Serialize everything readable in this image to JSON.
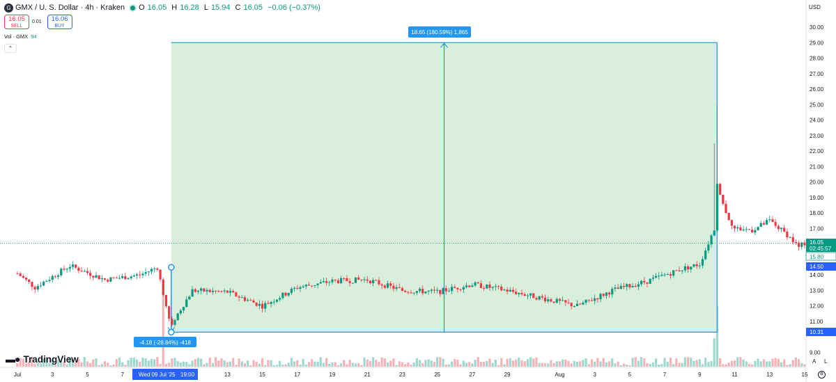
{
  "header": {
    "symbol_icon": "gmx-logo-icon",
    "title": "GMX / U. S. Dollar · 4h · Kraken",
    "open_label": "O",
    "open": "16.05",
    "high_label": "H",
    "high": "16.28",
    "low_label": "L",
    "low": "15.94",
    "close_label": "C",
    "close": "16.05",
    "change": "−0.06 (−0.37%)"
  },
  "trade": {
    "sell_price": "16.05",
    "sell_label": "SELL",
    "spread": "0.01",
    "buy_price": "16.06",
    "buy_label": "BUY"
  },
  "volume": {
    "label": "Vol · GMX",
    "value": "94"
  },
  "currency": "USD",
  "brand": "TradingView",
  "colors": {
    "up": "#089981",
    "down": "#f23645",
    "range_fill": "#d9eedb",
    "measure_blue": "#2962ff"
  },
  "measure": {
    "up_label": "18.65 (180.59%) 1,865",
    "down_label": "-4.18 (-28.84%) -418",
    "top_value": 29.0,
    "bottom_value": 10.31,
    "start_value": 14.5
  },
  "price_axis": {
    "ticks": [
      "30.00",
      "29.00",
      "28.00",
      "27.00",
      "26.00",
      "25.00",
      "24.00",
      "23.00",
      "22.00",
      "21.00",
      "20.00",
      "19.00",
      "18.00",
      "17.00",
      "14.00",
      "13.00",
      "12.00",
      "11.00",
      "9.00"
    ],
    "current_price": "16.05",
    "countdown": "02:45:57",
    "low_marker": "15.80",
    "start_marker": "14.50",
    "bottom_marker": "10.31"
  },
  "time_axis": {
    "labels": [
      "Jul",
      "3",
      "5",
      "7",
      "13",
      "15",
      "17",
      "19",
      "21",
      "23",
      "25",
      "27",
      "29",
      "Aug",
      "3",
      "5",
      "7",
      "9",
      "11",
      "13",
      "15"
    ],
    "crosshair_label": "Wed 09 Jul '25",
    "crosshair_time": "19:00"
  },
  "chart_data": {
    "type": "candlestick",
    "symbol": "GMX / U. S. Dollar",
    "interval": "4h",
    "exchange": "Kraken",
    "y_range": [
      8.5,
      30.5
    ],
    "x_range": [
      "2025-07-01",
      "2025-08-15"
    ],
    "anchors": [
      {
        "date": "2025-07-01",
        "close": 14.1
      },
      {
        "date": "2025-07-02",
        "close": 13.2
      },
      {
        "date": "2025-07-04",
        "close": 14.6
      },
      {
        "date": "2025-07-06",
        "close": 13.7
      },
      {
        "date": "2025-07-08",
        "close": 14.0
      },
      {
        "date": "2025-07-09",
        "close": 14.5
      },
      {
        "date": "2025-07-09T19:00",
        "close": 10.5
      },
      {
        "date": "2025-07-10",
        "close": 11.2
      },
      {
        "date": "2025-07-11",
        "close": 13.0
      },
      {
        "date": "2025-07-13",
        "close": 12.9
      },
      {
        "date": "2025-07-15",
        "close": 12.0
      },
      {
        "date": "2025-07-17",
        "close": 13.2
      },
      {
        "date": "2025-07-19",
        "close": 13.6
      },
      {
        "date": "2025-07-21",
        "close": 13.7
      },
      {
        "date": "2025-07-23",
        "close": 13.0
      },
      {
        "date": "2025-07-25",
        "close": 12.9
      },
      {
        "date": "2025-07-27",
        "close": 13.4
      },
      {
        "date": "2025-07-29",
        "close": 13.0
      },
      {
        "date": "2025-07-31",
        "close": 12.5
      },
      {
        "date": "2025-08-02",
        "close": 12.0
      },
      {
        "date": "2025-08-04",
        "close": 13.0
      },
      {
        "date": "2025-08-06",
        "close": 13.6
      },
      {
        "date": "2025-08-08",
        "close": 14.4
      },
      {
        "date": "2025-08-09",
        "close": 14.7
      },
      {
        "date": "2025-08-09T20:00",
        "close": 17.0
      },
      {
        "date": "2025-08-10",
        "close": 20.0
      },
      {
        "date": "2025-08-10T12:00",
        "close": 18.0
      },
      {
        "date": "2025-08-11",
        "close": 17.0
      },
      {
        "date": "2025-08-12",
        "close": 16.9
      },
      {
        "date": "2025-08-13",
        "close": 17.5
      },
      {
        "date": "2025-08-14",
        "close": 16.6
      },
      {
        "date": "2025-08-14T16:00",
        "close": 15.8
      },
      {
        "date": "2025-08-15",
        "close": 16.05
      }
    ],
    "spikes": [
      {
        "date": "2025-08-09T20:00",
        "high": 22.5
      },
      {
        "date": "2025-08-10",
        "high": 25.0
      }
    ]
  }
}
